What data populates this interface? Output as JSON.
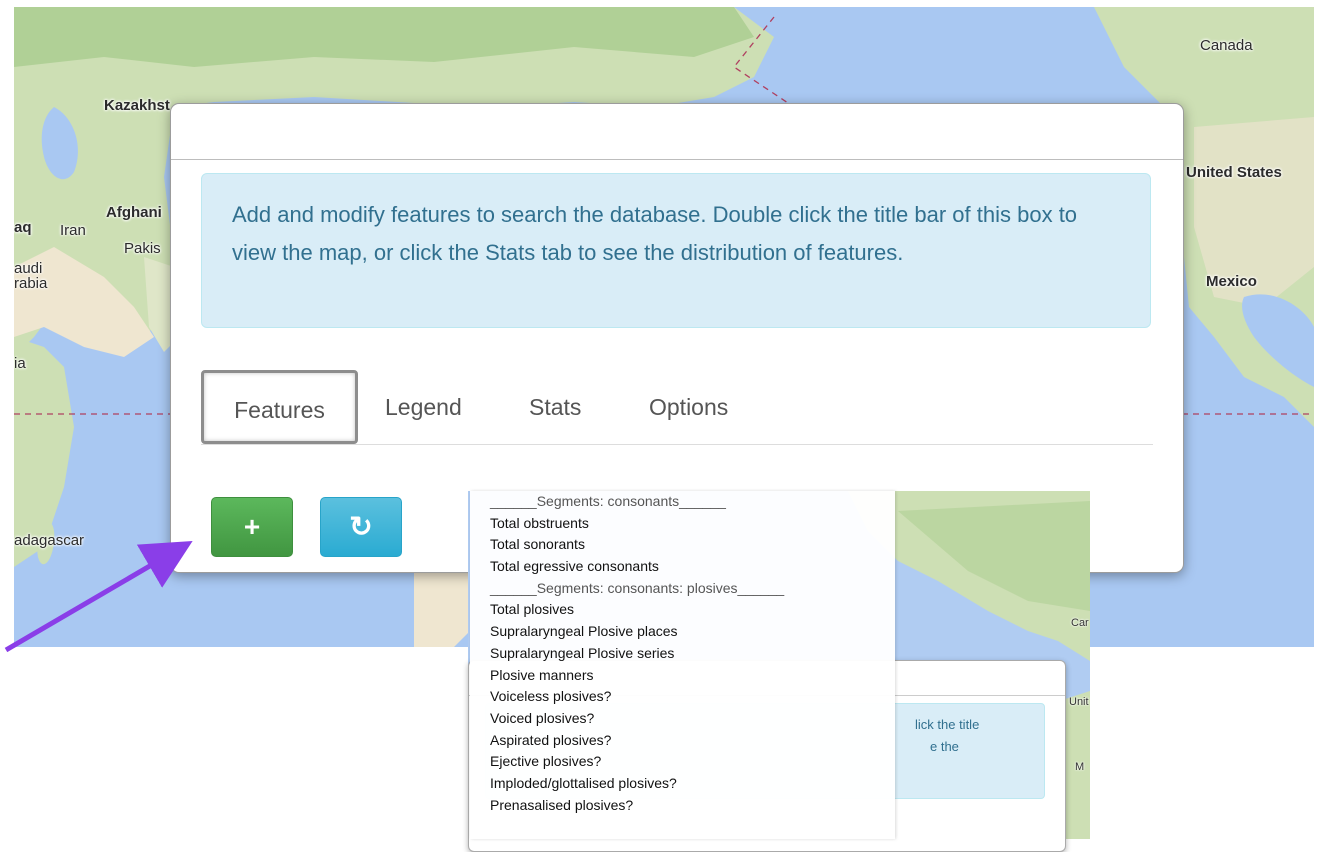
{
  "map": {
    "labels": {
      "canada": "Canada",
      "kazakhstan": "Kazakhst",
      "united_states": "United States",
      "afghanistan": "Afghani",
      "iraq": "aq",
      "iran": "Iran",
      "pakistan": "Pakis",
      "saudi_1": "audi",
      "saudi_2": "rabia",
      "mexico": "Mexico",
      "africa": "ia",
      "madagascar": "adagascar"
    },
    "colors": {
      "ocean": "#a9c8f2",
      "land": "#dfe8cf",
      "forest": "#b9d5a0",
      "desert": "#efe6d0"
    }
  },
  "dialog": {
    "info_text": "Add and modify features to search the database. Double click the title bar of this box to view the map, or click the Stats tab to see the distribution of features.",
    "tabs": [
      {
        "label": "Features",
        "active": true
      },
      {
        "label": "Legend",
        "active": false
      },
      {
        "label": "Stats",
        "active": false
      },
      {
        "label": "Options",
        "active": false
      }
    ],
    "add_button_icon": "+",
    "reset_button_icon": "↻"
  },
  "inset": {
    "info_line1_visible": "lick the title",
    "info_line2_visible": "e the",
    "labels": {
      "ca": "Car",
      "unit": "Unit",
      "m": "M"
    }
  },
  "dropdown": {
    "items": [
      {
        "label": "______Segments: consonants______",
        "header": true
      },
      {
        "label": "Total obstruents",
        "header": false
      },
      {
        "label": "Total sonorants",
        "header": false
      },
      {
        "label": "Total egressive consonants",
        "header": false
      },
      {
        "label": "______Segments: consonants: plosives______",
        "header": true
      },
      {
        "label": "Total plosives",
        "header": false
      },
      {
        "label": "Supralaryngeal Plosive places",
        "header": false
      },
      {
        "label": "Supralaryngeal Plosive series",
        "header": false
      },
      {
        "label": "Plosive manners",
        "header": false
      },
      {
        "label": "Voiceless plosives?",
        "header": false
      },
      {
        "label": "Voiced plosives?",
        "header": false
      },
      {
        "label": "Aspirated plosives?",
        "header": false
      },
      {
        "label": "Ejective plosives?",
        "header": false
      },
      {
        "label": "Imploded/glottalised plosives?",
        "header": false
      },
      {
        "label": "Prenasalised plosives?",
        "header": false
      }
    ]
  }
}
